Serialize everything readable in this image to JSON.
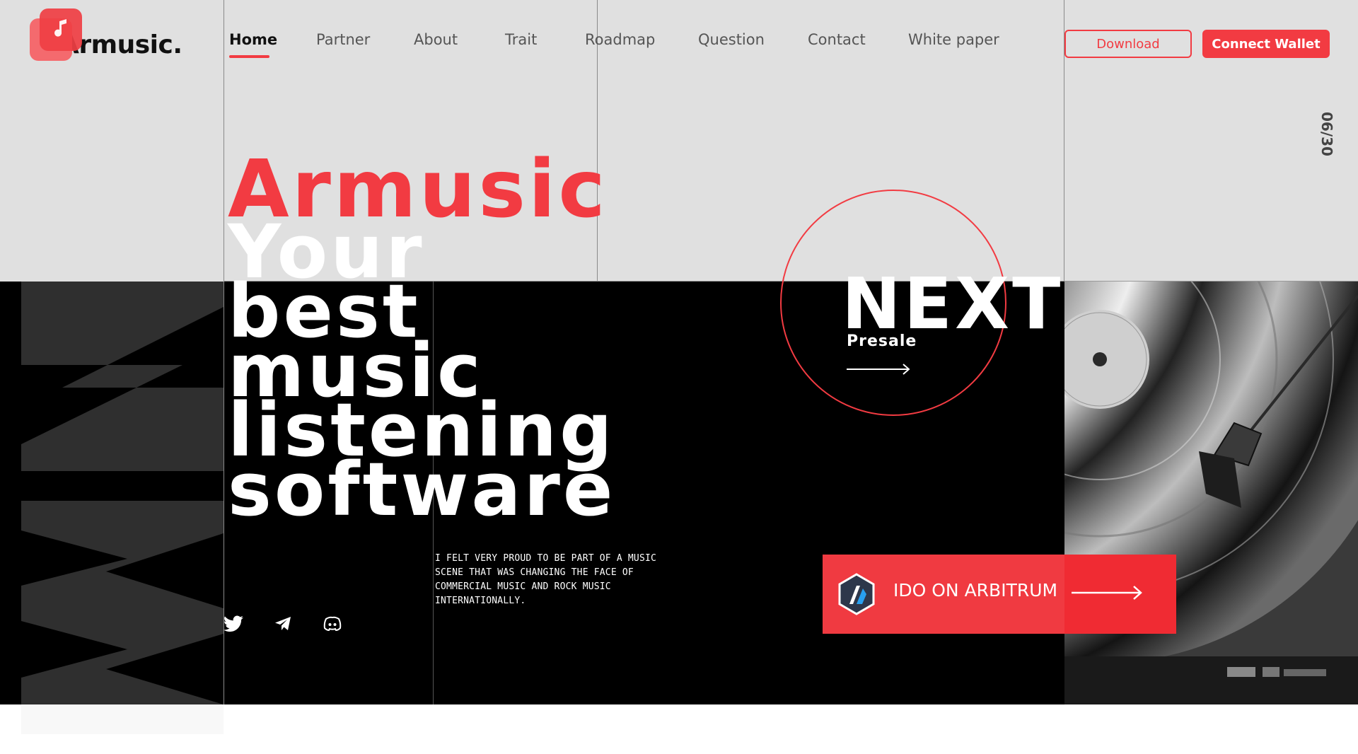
{
  "brand": {
    "name": "Armusic.",
    "logo_icon": "music-note-icon"
  },
  "nav": {
    "items": [
      {
        "label": "Home",
        "active": true
      },
      {
        "label": "Partner",
        "active": false
      },
      {
        "label": "About",
        "active": false
      },
      {
        "label": "Trait",
        "active": false
      },
      {
        "label": "Roadmap",
        "active": false
      },
      {
        "label": "Question",
        "active": false
      },
      {
        "label": "Contact",
        "active": false
      },
      {
        "label": "White paper",
        "active": false
      }
    ]
  },
  "actions": {
    "download_label": "Download",
    "connect_wallet_label": "Connect Wallet"
  },
  "page_counter": "06/30",
  "hero": {
    "brand_word": "Armusic",
    "lines": [
      "Your",
      "best",
      "music",
      "listening",
      "software"
    ],
    "background_letters": "NW"
  },
  "description": "I felt very proud to be part of a music scene that was changing the face of commercial music and rock music internationally.",
  "socials": [
    {
      "icon": "twitter-icon"
    },
    {
      "icon": "telegram-icon"
    },
    {
      "icon": "discord-icon"
    }
  ],
  "next": {
    "title": "NEXT",
    "subtitle": "Presale"
  },
  "ido": {
    "label": "IDO ON ARBITRUM",
    "icon": "arbitrum-logo-icon"
  },
  "colors": {
    "accent": "#f23b42",
    "top_background": "#e0e0e0",
    "dark_background": "#000000"
  }
}
